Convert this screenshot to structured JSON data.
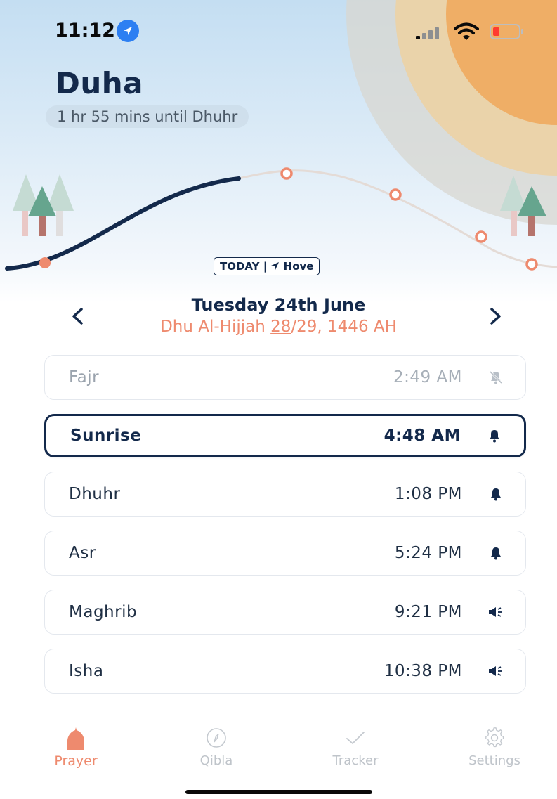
{
  "status_bar": {
    "time": "11:12",
    "location_icon": "location-arrow-icon",
    "signal_icon": "cellular-signal-icon",
    "wifi_icon": "wifi-icon",
    "battery_icon": "battery-low-icon"
  },
  "header": {
    "current_period": "Duha",
    "countdown": "1 hr 55 mins until Dhuhr"
  },
  "sun_arc": {
    "badge_today": "TODAY",
    "badge_separator": "|",
    "badge_location": "Hove"
  },
  "date_nav": {
    "prev_icon": "chevron-left-icon",
    "next_icon": "chevron-right-icon",
    "prev_label": "<",
    "next_label": ">",
    "gregorian": "Tuesday 24th June",
    "hijri_month": "Dhu Al-Hijjah",
    "hijri_day": "28",
    "hijri_rest": "/29, 1446 AH"
  },
  "prayers": [
    {
      "name": "Fajr",
      "time": "2:49 AM",
      "alert": "bell-off-icon",
      "state": "past"
    },
    {
      "name": "Sunrise",
      "time": "4:48 AM",
      "alert": "bell-icon",
      "state": "active"
    },
    {
      "name": "Dhuhr",
      "time": "1:08 PM",
      "alert": "bell-icon",
      "state": "upcoming"
    },
    {
      "name": "Asr",
      "time": "5:24 PM",
      "alert": "bell-icon",
      "state": "upcoming"
    },
    {
      "name": "Maghrib",
      "time": "9:21 PM",
      "alert": "speaker-icon",
      "state": "upcoming"
    },
    {
      "name": "Isha",
      "time": "10:38 PM",
      "alert": "speaker-icon",
      "state": "upcoming"
    }
  ],
  "tabbar": {
    "items": [
      {
        "label": "Prayer",
        "icon": "mosque-dome-icon",
        "active": true
      },
      {
        "label": "Qibla",
        "icon": "compass-icon",
        "active": false
      },
      {
        "label": "Tracker",
        "icon": "checkmark-icon",
        "active": false
      },
      {
        "label": "Settings",
        "icon": "gear-icon",
        "active": false
      }
    ]
  },
  "colors": {
    "navy": "#13294b",
    "accent": "#ee8a6e",
    "sun": "#f0b06a",
    "sky": "#c4def2"
  }
}
